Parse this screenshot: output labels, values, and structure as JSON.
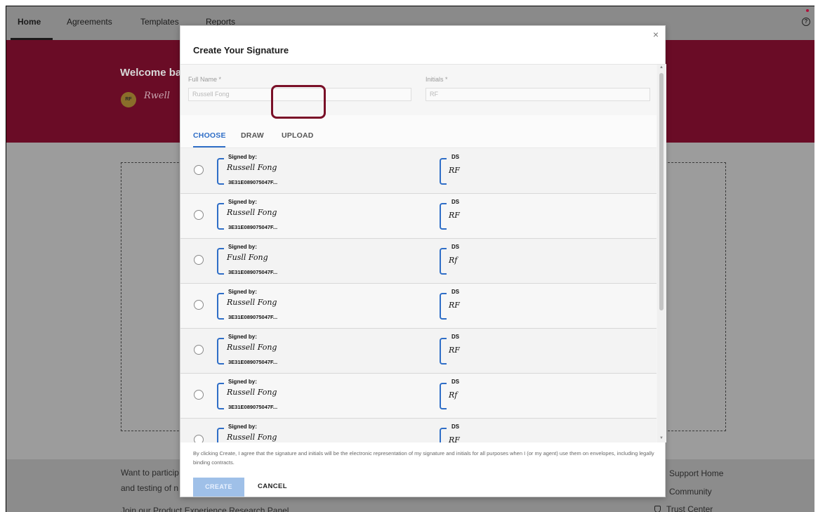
{
  "nav": {
    "home": "Home",
    "agreements": "Agreements",
    "templates": "Templates",
    "reports": "Reports"
  },
  "hero": {
    "welcome": "Welcome ba",
    "avatar_initials": "RF",
    "signature_preview": "Rwell"
  },
  "footer": {
    "line1": "Want to particip",
    "line2": "and testing of n",
    "line3": "Join our Product Experience Research Panel",
    "support_home": "Support Home",
    "community": "Community",
    "trust_center": "Trust Center"
  },
  "modal": {
    "title": "Create Your Signature",
    "close_symbol": "×",
    "full_name_label": "Full Name *",
    "full_name_value": "Russell Fong",
    "initials_label": "Initials *",
    "initials_value": "RF",
    "tabs": {
      "choose": "CHOOSE",
      "draw": "DRAW",
      "upload": "UPLOAD"
    },
    "signed_by_label": "Signed by:",
    "ds_label": "DS",
    "envelope_id": "3E31E089075047F...",
    "options": [
      {
        "signature": "Russell Fong",
        "initials": "RF"
      },
      {
        "signature": "Russell Fong",
        "initials": "RF"
      },
      {
        "signature": "Fusll Fong",
        "initials": "Rf"
      },
      {
        "signature": "Russell Fong",
        "initials": "RF"
      },
      {
        "signature": "Russell Fong",
        "initials": "RF"
      },
      {
        "signature": "Russell Fong",
        "initials": "Rf"
      },
      {
        "signature": "Russell Fong",
        "initials": "RF"
      }
    ],
    "consent": "By clicking Create, I agree that the signature and initials will be the electronic representation of my signature and initials for all purposes when I (or my agent) use them on envelopes, including legally binding contracts.",
    "create_button": "CREATE",
    "cancel_button": "CANCEL"
  }
}
